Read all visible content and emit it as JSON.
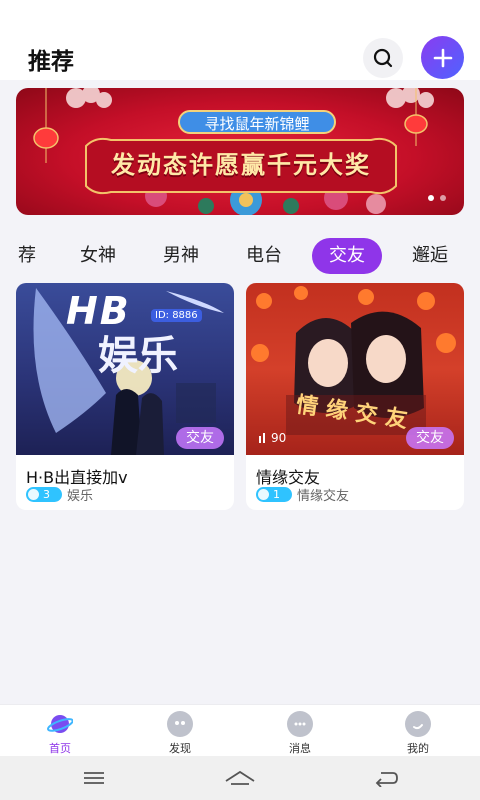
{
  "header": {
    "title": "推荐"
  },
  "banner": {
    "subtitle": "寻找鼠年新锦鲤",
    "headline": "发动态许愿赢千元大奖",
    "slide_count": 2,
    "active_slide": 1,
    "color": "#d2152f"
  },
  "tabs": [
    {
      "label": "荐",
      "active": false
    },
    {
      "label": "女神",
      "active": false
    },
    {
      "label": "男神",
      "active": false
    },
    {
      "label": "电台",
      "active": false
    },
    {
      "label": "交友",
      "active": true
    },
    {
      "label": "邂逅",
      "active": false
    }
  ],
  "cards": [
    {
      "image_text_big": "HB",
      "image_text_main": "娱乐",
      "image_text_id": "ID: 8886",
      "badge": "交友",
      "title": "H·B出直接加v",
      "count": "3",
      "category": "娱乐"
    },
    {
      "image_text_art": "情缘交友",
      "image_counter": "90",
      "badge": "交友",
      "title": "情缘交友",
      "count": "1",
      "category": "情缘交友"
    }
  ],
  "tabbar": [
    {
      "label": "首页",
      "icon": "planet-icon",
      "active": true
    },
    {
      "label": "发现",
      "icon": "discover-icon",
      "active": false
    },
    {
      "label": "消息",
      "icon": "message-icon",
      "active": false
    },
    {
      "label": "我的",
      "icon": "profile-icon",
      "active": false
    }
  ],
  "colors": {
    "accent": "#8f35e9",
    "count_pill": "#2fc3ff"
  }
}
